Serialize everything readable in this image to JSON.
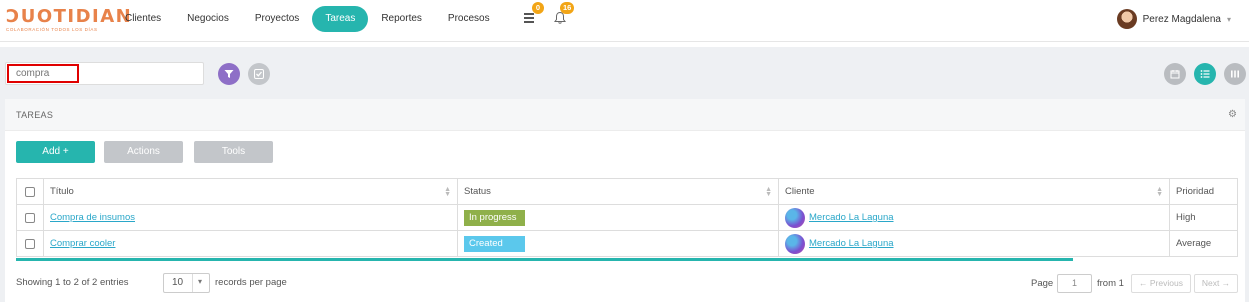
{
  "brand": {
    "name": "ƆUOTIDIAN",
    "tagline": "COLABORACIÓN TODOS LOS DÍAS",
    "color": "#e8824a"
  },
  "nav": {
    "items": [
      {
        "label": "Clientes"
      },
      {
        "label": "Negocios"
      },
      {
        "label": "Proyectos"
      },
      {
        "label": "Tareas",
        "active": true
      },
      {
        "label": "Reportes"
      },
      {
        "label": "Procesos"
      }
    ],
    "tasks_badge": "0",
    "notifications_badge": "16"
  },
  "user": {
    "name": "Perez Magdalena"
  },
  "search": {
    "value": "",
    "placeholder": "compra"
  },
  "panel": {
    "title": "TAREAS",
    "buttons": {
      "add": "Add +",
      "actions": "Actions",
      "tools": "Tools"
    }
  },
  "table": {
    "columns": [
      "Título",
      "Status",
      "Cliente",
      "Prioridad"
    ],
    "rows": [
      {
        "titulo": "Compra de insumos",
        "status": "In progress",
        "status_color": "#8fb04a",
        "cliente": "Mercado La Laguna",
        "prioridad": "High"
      },
      {
        "titulo": "Comprar cooler",
        "status": "Created",
        "status_color": "#5bc8ec",
        "cliente": "Mercado La Laguna",
        "prioridad": "Average"
      }
    ]
  },
  "footer": {
    "showing": "Showing 1 to 2 of 2 entries",
    "per_page_value": "10",
    "records_per_page": "records per page",
    "page_label": "Page",
    "page_value": "1",
    "from_label": "from 1",
    "previous": "← Previous",
    "next": "Next →"
  },
  "colors": {
    "accent": "#26b5ae",
    "filter": "#8e6fc7",
    "badge": "#f2a516"
  }
}
